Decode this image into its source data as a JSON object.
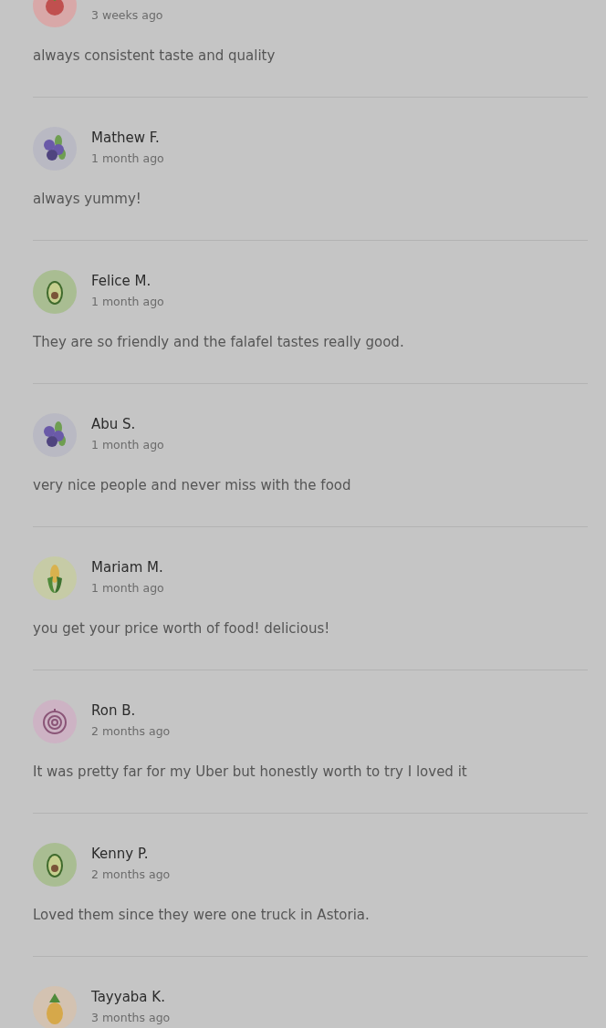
{
  "reviews": [
    {
      "kind": "tomato",
      "time": "3 weeks ago",
      "comment": "always consistent taste and quality"
    },
    {
      "kind": "blueberry",
      "name": "Mathew F.",
      "time": "1 month ago",
      "comment": "always yummy!"
    },
    {
      "kind": "avocado",
      "name": "Felice M.",
      "time": "1 month ago",
      "comment": "They are so friendly and the falafel tastes really good."
    },
    {
      "kind": "blueberry",
      "name": "Abu S.",
      "time": "1 month ago",
      "comment": "very nice people and never miss with the food"
    },
    {
      "kind": "corn",
      "name": "Mariam M.",
      "time": "1 month ago",
      "comment": "you get your price worth of food! delicious!"
    },
    {
      "kind": "onion",
      "name": "Ron B.",
      "time": "2 months ago",
      "comment": "It was pretty far for my Uber but honestly worth to try I loved it"
    },
    {
      "kind": "avocado",
      "name": "Kenny P.",
      "time": "2 months ago",
      "comment": "Loved them since they were one truck in Astoria."
    },
    {
      "kind": "pineapple",
      "name": "Tayyaba K.",
      "time": "3 months ago"
    }
  ]
}
